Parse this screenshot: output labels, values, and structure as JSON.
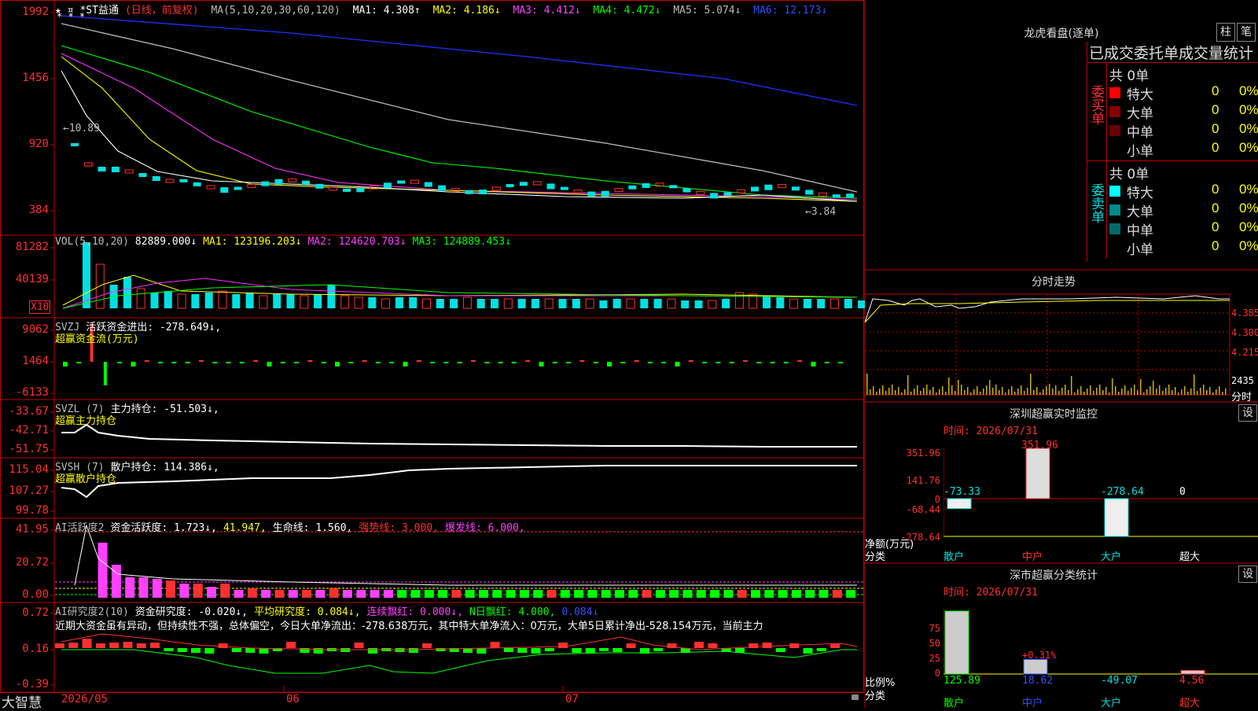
{
  "stock": {
    "marks": "★ ¤",
    "asterisks": "* * *",
    "name": "*ST益通",
    "period": "(日线，前复权)",
    "ma_def": "MA(5,10,20,30,60,120)",
    "ma1": "MA1: 4.308↑",
    "ma2": "MA2: 4.186↓",
    "ma3": "MA3: 4.412↓",
    "ma4": "MA4: 4.472↓",
    "ma5": "MA5: 5.074↓",
    "ma6": "MA6: 12.173↓",
    "price_axis": [
      "1992",
      "1456",
      "920",
      "384"
    ],
    "high_note": "←10.89",
    "low_note": "←3.84"
  },
  "vol": {
    "def": "VOL(5,10,20)",
    "val": "82889.000↓",
    "ma1": "MA1: 123196.203↓",
    "ma2": "MA2: 124620.703↓",
    "ma3": "MA3: 124889.453↓",
    "axis": [
      "81282",
      "40139"
    ],
    "unit": "X10"
  },
  "svzj": {
    "def": "SVZJ",
    "text": "活跃资金进出: -278.649↓,",
    "sub": "超赢资金流(万元)",
    "axis": [
      "9062",
      "1464",
      "-6133"
    ]
  },
  "svzl": {
    "def": "SVZL (7)",
    "text": "主力持仓: -51.503↓,",
    "sub": "超赢主力持仓",
    "axis": [
      "-33.67",
      "-42.71",
      "-51.75"
    ]
  },
  "svsh": {
    "def": "SVSH (7)",
    "text": "散户持仓: 114.386↓,",
    "sub": "超赢散户持仓",
    "axis": [
      "115.04",
      "107.27",
      "99.78"
    ]
  },
  "ai1": {
    "def": "AI活跃度2",
    "a": "资金活跃度: 1.723↓,",
    "b": "41.947,",
    "c": "生命线: 1.560,",
    "d": "强势线: 3.000,",
    "e": "爆发线: 6.000,",
    "axis": [
      "41.95",
      "20.72",
      "0.00"
    ]
  },
  "ai2": {
    "def": "AI研究度2(10)",
    "a": "资金研究度: -0.020↓,",
    "b": "平均研究度: 0.084↓,",
    "c": "连续飘红: 0.000↓,",
    "d": "N日飘红: 4.000,",
    "e": "0.084↓",
    "note": "近期大资金虽有异动，但持续性不强，总体偏空，今日大单净流出：-278.638万元，其中特大单净流入：0万元，大单5日累计净出-528.154万元，当前主力",
    "axis": [
      "0.72",
      "0.16",
      "-0.39"
    ]
  },
  "footer": {
    "brand": "大智慧",
    "dates": [
      "2026/05",
      "06",
      "07"
    ]
  },
  "dragon": {
    "title": "龙虎看盘(逐单)",
    "btn1": "柱",
    "btn2": "笔",
    "header": "已成交委托单成交量统计",
    "buy_label": "委买单",
    "sell_label": "委卖单",
    "buy_total": "共 0单",
    "sell_total": "共 0单",
    "buy_rows": [
      {
        "name": "特大",
        "val": "0",
        "pct": "0%",
        "color": "#ff0000"
      },
      {
        "name": "大单",
        "val": "0",
        "pct": "0%",
        "color": "#8a0000"
      },
      {
        "name": "中单",
        "val": "0",
        "pct": "0%",
        "color": "#6a0000"
      },
      {
        "name": "小单",
        "val": "0",
        "pct": "0%",
        "color": "#000000"
      }
    ],
    "sell_rows": [
      {
        "name": "特大",
        "val": "0",
        "pct": "0%",
        "color": "#00ffff"
      },
      {
        "name": "大单",
        "val": "0",
        "pct": "0%",
        "color": "#008a8a"
      },
      {
        "name": "中单",
        "val": "0",
        "pct": "0%",
        "color": "#006a6a"
      },
      {
        "name": "小单",
        "val": "0",
        "pct": "0%",
        "color": "#000000"
      }
    ]
  },
  "intraday": {
    "title": "分时走势",
    "axis": [
      "4.385",
      "4.300",
      "4.215"
    ],
    "vol_axis": "2435",
    "vol_label": "分时"
  },
  "monitor": {
    "title": "深圳超赢实时监控",
    "btn": "设",
    "time_label": "时间: 2026/07/31",
    "axis": [
      "351.96",
      "141.76",
      "0",
      "-68.44",
      "-278.64"
    ],
    "unit_label": "净额(万元)",
    "cat_label": "分类",
    "categories": [
      "散户",
      "中户",
      "大户",
      "超大"
    ],
    "values_text": [
      "-73.33",
      "351.96",
      "-278.64",
      "0"
    ]
  },
  "stats": {
    "title": "深市超赢分类统计",
    "btn": "设",
    "time_label": "时间: 2026/07/31",
    "axis": [
      "75",
      "50",
      "25",
      "0"
    ],
    "ratio_label": "比例%",
    "cat_label": "分类",
    "categories": [
      "散户",
      "中户",
      "大户",
      "超大"
    ],
    "values_text": [
      "125.89",
      "18.62",
      "-49.07",
      "4.56"
    ],
    "bar_note": "+0.31%"
  }
}
